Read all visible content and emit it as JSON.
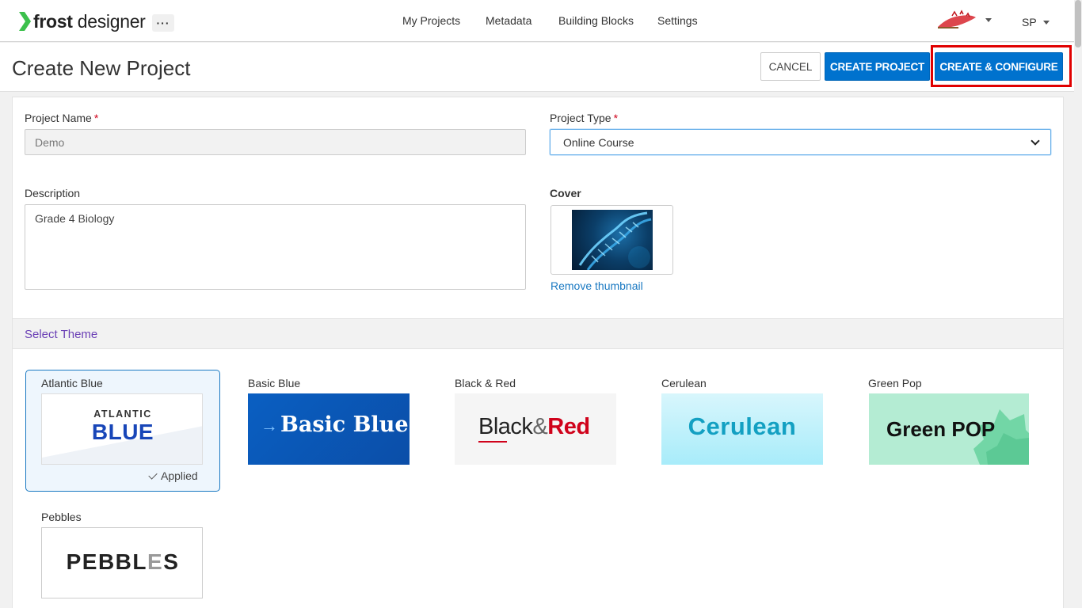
{
  "app": {
    "logo_bold": "frost",
    "logo_light": "designer",
    "more_label": "···"
  },
  "nav": {
    "items": [
      {
        "label": "My Projects"
      },
      {
        "label": "Metadata"
      },
      {
        "label": "Building Blocks"
      },
      {
        "label": "Settings"
      }
    ],
    "user_initials": "SP"
  },
  "header": {
    "title": "Create New Project",
    "cancel_label": "CANCEL",
    "create_label": "CREATE PROJECT",
    "configure_label": "CREATE & CONFIGURE"
  },
  "form": {
    "project_name": {
      "label": "Project Name",
      "required_mark": "*",
      "value": "Demo"
    },
    "project_type": {
      "label": "Project Type",
      "required_mark": "*",
      "value": "Online Course"
    },
    "description": {
      "label": "Description",
      "value": "Grade 4 Biology"
    },
    "cover": {
      "label": "Cover",
      "remove_label": "Remove thumbnail"
    }
  },
  "themes": {
    "section_title": "Select Theme",
    "applied_label": "Applied",
    "items": [
      {
        "name": "Atlantic Blue",
        "thumb_line1": "ATLANTIC",
        "thumb_line2": "BLUE",
        "applied": true
      },
      {
        "name": "Basic Blue",
        "thumb_text": "Basic Blue"
      },
      {
        "name": "Black & Red",
        "thumb_part1": "Black",
        "thumb_amp": "&",
        "thumb_part2": "Red"
      },
      {
        "name": "Cerulean",
        "thumb_text": "Cerulean"
      },
      {
        "name": "Green Pop",
        "thumb_text": "Green POP"
      },
      {
        "name": "Pebbles",
        "thumb_part1": "PEBBL",
        "thumb_part2": "E",
        "thumb_part3": "S"
      }
    ]
  },
  "colors": {
    "primary": "#0072ce",
    "highlight": "#e00000",
    "theme_section_title": "#6a3fb5",
    "logo_green": "#3cc04c"
  }
}
